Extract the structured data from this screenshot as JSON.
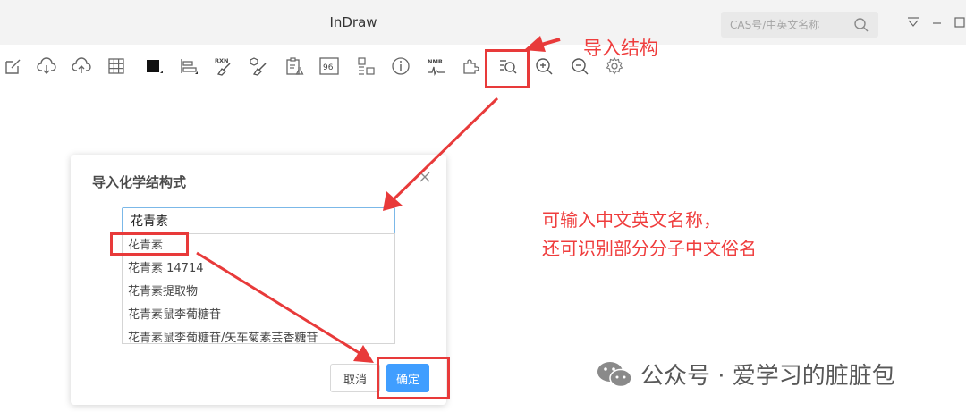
{
  "app": {
    "title": "InDraw"
  },
  "search": {
    "placeholder": "CAS号/中英文名称"
  },
  "toolbar": {
    "rxn_label": "RXN",
    "num_label": "96",
    "nmr_label": "NMR"
  },
  "dialog": {
    "title": "导入化学结构式",
    "input_value": "花青素",
    "suggestions": [
      "花青素",
      "花青素 14714",
      "花青素提取物",
      "花青素鼠李葡糖苷",
      "花青素鼠李葡糖苷/矢车菊素芸香糖苷"
    ],
    "cancel_label": "取消",
    "ok_label": "确定"
  },
  "annotations": {
    "import_structure": "导入结构",
    "note_line1": "可输入中文英文名称，",
    "note_line2": "还可识别部分分子中文俗名"
  },
  "watermark": {
    "text": "公众号 · 爱学习的脏脏包"
  },
  "colors": {
    "accent_red": "#e83a3a",
    "button_blue": "#409eff",
    "titlebar": "#f3f3f3"
  }
}
